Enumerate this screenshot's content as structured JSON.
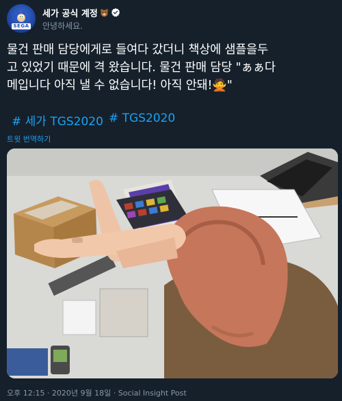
{
  "account": {
    "name": "세가 공식 계정",
    "handle": "안녕하세요.",
    "avatar_logo_text": "SEGA",
    "verified": true
  },
  "tweet": {
    "lines": [
      "물건 판매 담당에게로 들여다 갔더니 책상에 샘플을두",
      "고 있었기 때문에 격 왔습니다. 물건 판매 담당 \"ぁぁ다",
      "메입니다 아직 낼 수 없습니다! 아직 안돼!🙅\""
    ],
    "hashtags": [
      "# 세가 TGS2020",
      "# TGS2020"
    ],
    "translate_label": "트윗 번역하기"
  },
  "photo": {
    "description_icon": "photo-icon"
  },
  "meta": {
    "text": "오후 12:15 · 2020년 9월 18일 · Social Insight Post"
  },
  "colors": {
    "background": "#15202b",
    "accent": "#1da1f2",
    "secondary_text": "#8899a6"
  }
}
